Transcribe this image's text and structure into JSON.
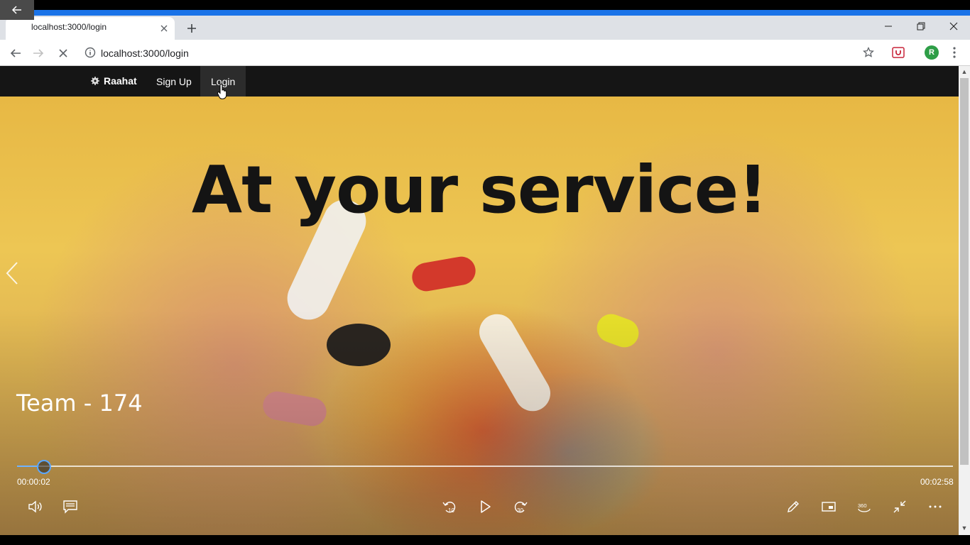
{
  "browser": {
    "tab_title": "localhost:3000/login",
    "url": "localhost:3000/login",
    "profile_initial": "R"
  },
  "site": {
    "brand": "Raahat",
    "nav": [
      {
        "label": "Sign Up"
      },
      {
        "label": "Login",
        "active": true
      }
    ],
    "hero_title": "At your service!"
  },
  "player": {
    "title": "Team - 174",
    "current_time": "00:00:02",
    "total_time": "00:02:58",
    "progress": 0.011,
    "skip_back_label": "10",
    "skip_forward_label": "30",
    "view_360_label": "360"
  },
  "colors": {
    "progress_accent": "#6fb3ff",
    "load_bar": "#1a73e8",
    "navbar_bg": "#151515",
    "avatar_bg": "#2e9e47"
  },
  "icons": [
    "back-arrow-icon",
    "close-icon",
    "plus-icon",
    "minimize-icon",
    "restore-icon",
    "info-icon",
    "star-icon",
    "extension-icon",
    "menu-icon",
    "settings-icon",
    "chevron-left-icon",
    "volume-icon",
    "captions-icon",
    "rewind-10-icon",
    "play-icon",
    "forward-30-icon",
    "pen-icon",
    "miniplayer-icon",
    "360-icon",
    "exit-fullscreen-icon",
    "more-icon"
  ]
}
